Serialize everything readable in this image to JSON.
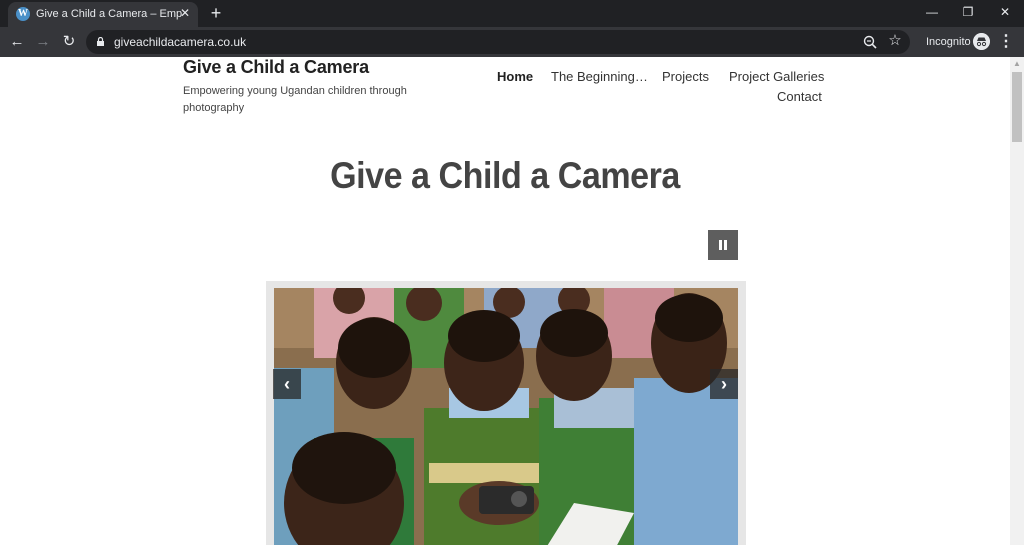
{
  "browser": {
    "tab": {
      "title": "Give a Child a Camera – Empowe",
      "close_glyph": "✕"
    },
    "new_tab_glyph": "+",
    "window_controls": {
      "minimize": "—",
      "restore": "❐",
      "close": "✕"
    },
    "nav": {
      "back": "←",
      "forward": "→",
      "reload": "↻"
    },
    "url": "giveachildacamera.co.uk",
    "bookmark_glyph": "☆",
    "incognito_label": "Incognito",
    "menu_glyph": "⋮",
    "scroll_up_glyph": "▲",
    "icons": [
      "wordpress-icon",
      "lock-icon",
      "zoom-icon",
      "star-icon",
      "incognito-icon",
      "kebab-menu-icon"
    ]
  },
  "site": {
    "title": "Give a Child a Camera",
    "description": "Empowering young Ugandan children through photography"
  },
  "nav": {
    "items": [
      {
        "label": "Home",
        "active": true
      },
      {
        "label": "The Beginning…",
        "active": false
      },
      {
        "label": "Projects",
        "active": false
      },
      {
        "label": "Project Galleries",
        "active": false
      },
      {
        "label": "Contact",
        "active": false
      }
    ]
  },
  "main": {
    "heading": "Give a Child a Camera"
  },
  "slider": {
    "prev_glyph": "‹",
    "next_glyph": "›",
    "image_subject": "children-with-camera-photo",
    "colors": {
      "frame": "#e6e6e6",
      "control_bg": "#282828"
    }
  }
}
